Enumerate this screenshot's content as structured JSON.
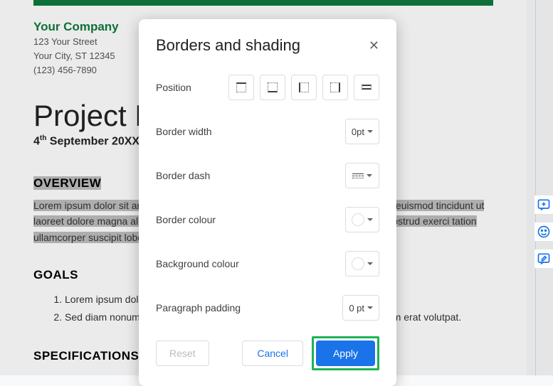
{
  "doc": {
    "company": "Your Company",
    "address1": "123 Your Street",
    "address2": "Your City, ST 12345",
    "phone": "(123) 456-7890",
    "title": "Project Name",
    "date_prefix": "4",
    "date_suffix": "th",
    "date_rest": " September 20XX",
    "overview_h": "OVERVIEW",
    "overview_p": "Lorem ipsum dolor sit amet, consectetuer adipiscing elit, sed diam nonummy nibh euismod tincidunt ut laoreet dolore magna aliquam erat volutpat. Ut wisi enim ad minim veniam, quis nostrud exerci tation ullamcorper suscipit lobortis.",
    "goals_h": "GOALS",
    "goal1": "Lorem ipsum dolor sit amet, consectetuer adipiscing elit.",
    "goal2": "Sed diam nonummy nibh euismod tincidunt ut laoreet dolore magna aliquam erat volutpat.",
    "spec_h": "SPECIFICATIONS"
  },
  "dialog": {
    "title": "Borders and shading",
    "rows": {
      "position": "Position",
      "width": "Border width",
      "dash": "Border dash",
      "colour": "Border colour",
      "bg": "Background colour",
      "padding": "Paragraph padding"
    },
    "width_val": "0pt",
    "padding_val": "0 pt",
    "buttons": {
      "reset": "Reset",
      "cancel": "Cancel",
      "apply": "Apply"
    }
  }
}
